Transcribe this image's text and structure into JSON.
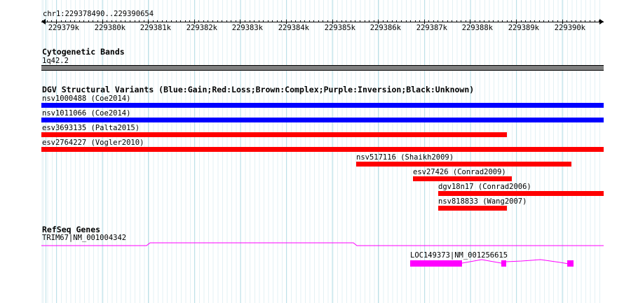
{
  "ruler": {
    "region": "chr1:229378490..229390654",
    "ticks": [
      "229379k",
      "229380k",
      "229381k",
      "229382k",
      "229383k",
      "229384k",
      "229385k",
      "229386k",
      "229387k",
      "229388k",
      "229389k",
      "229390k"
    ]
  },
  "cyto": {
    "title": "Cytogenetic Bands",
    "band_label": "1q42.2"
  },
  "dgv": {
    "title": "DGV Structural Variants (Blue:Gain;Red:Loss;Brown:Complex;Purple:Inversion;Black:Unknown)",
    "variants": [
      {
        "label": "nsv1000488 (Coe2014)",
        "type": "gain"
      },
      {
        "label": "nsv1011066 (Coe2014)",
        "type": "gain"
      },
      {
        "label": "esv3693135 (Palta2015)",
        "type": "loss"
      },
      {
        "label": "esv2764227 (Vogler2010)",
        "type": "loss"
      },
      {
        "label": "nsv517116 (Shaikh2009)",
        "type": "loss"
      },
      {
        "label": "esv27426 (Conrad2009)",
        "type": "loss"
      },
      {
        "label": "dgv18n17 (Conrad2006)",
        "type": "loss"
      },
      {
        "label": "nsv818833 (Wang2007)",
        "type": "loss"
      }
    ]
  },
  "refseq": {
    "title": "RefSeq Genes",
    "genes": [
      {
        "label": "TRIM67|NM_001004342"
      },
      {
        "label": "LOC149373|NM_001256615"
      }
    ]
  },
  "colors": {
    "gain": "#0000ff",
    "loss": "#ff0000",
    "gene": "#ff00ff",
    "band": "#808080",
    "grid_major": "#bde1e8",
    "grid_minor": "#e3f1f4"
  }
}
